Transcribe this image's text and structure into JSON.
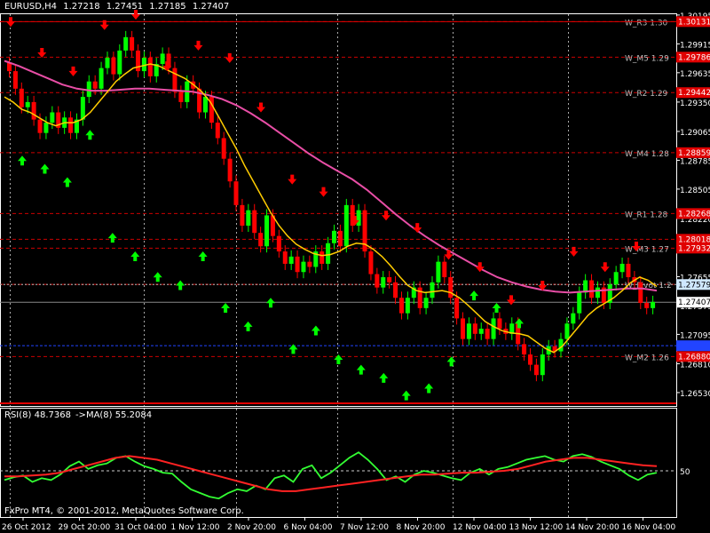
{
  "header": {
    "symbol": "EURUSD,H4",
    "open": "1.27218",
    "high": "1.27451",
    "low": "1.27185",
    "close": "1.27407"
  },
  "rsi_header": {
    "label": "RSI(8) 48.7368",
    "ma_label": "->MA(8) 55.2084"
  },
  "copyright": "FxPro MT4, © 2001-2012, MetaQuotes Software Corp.",
  "colors": {
    "background": "#000000",
    "axis": "#ffffff",
    "bull": "#00ff00",
    "bear": "#ff0000",
    "fast_ma": "#ffcc00",
    "slow_ma": "#e84ea6",
    "level_line": "#cc0000",
    "rsi": "#33ff33",
    "rsi_ma": "#ff2222"
  },
  "chart_data": [
    {
      "type": "candlestick",
      "title": "EURUSD,H4",
      "ylim": [
        1.264,
        1.3022
      ],
      "y_ticks": [
        "1.30195",
        "1.29915",
        "1.29635",
        "1.29350",
        "1.29065",
        "1.28785",
        "1.28505",
        "1.28220",
        "1.27655",
        "1.27375",
        "1.27095",
        "1.26810",
        "1.26530"
      ],
      "x_ticks": [
        "26 Oct 2012",
        "29 Oct 20:00",
        "31 Oct 04:00",
        "1 Nov 12:00",
        "2 Nov 20:00",
        "6 Nov 04:00",
        "7 Nov 12:00",
        "8 Nov 20:00",
        "12 Nov 04:00",
        "13 Nov 12:00",
        "14 Nov 20:00",
        "16 Nov 04:00"
      ],
      "grid": true,
      "current_price": "1.27407",
      "highlight_price": "1.27579",
      "levels": [
        {
          "name": "W_R3 1.30",
          "value": 1.30131,
          "tag": "1.30131"
        },
        {
          "name": "W_M5 1.29",
          "value": 1.29786,
          "tag": "1.29786"
        },
        {
          "name": "W_R2 1.29",
          "value": 1.29442,
          "tag": "1.29442"
        },
        {
          "name": "W_M4 1.28",
          "value": 1.28859,
          "tag": "1.28859"
        },
        {
          "name": "W_R1 1.28",
          "value": 1.28268,
          "tag": "1.28268"
        },
        {
          "name": "",
          "value": 1.28018,
          "tag": "1.28018"
        },
        {
          "name": "W_M3 1.27",
          "value": 1.27932,
          "tag": "1.27932"
        },
        {
          "name": "W_Pivot 1.2",
          "value": 1.2758,
          "tag": ""
        },
        {
          "name": "W_M2 1.26",
          "value": 1.2688,
          "tag": "1.26880"
        }
      ],
      "blue_level": 1.26985,
      "closes": [
        1.2965,
        1.2948,
        1.293,
        1.2935,
        1.2918,
        1.2905,
        1.2915,
        1.2925,
        1.291,
        1.292,
        1.2905,
        1.2918,
        1.294,
        1.2955,
        1.2948,
        1.2968,
        1.2978,
        1.2962,
        1.2985,
        1.2998,
        1.2985,
        1.2965,
        1.2978,
        1.296,
        1.2972,
        1.2982,
        1.2968,
        1.2945,
        1.2935,
        1.2955,
        1.2948,
        1.2925,
        1.294,
        1.2915,
        1.29,
        1.288,
        1.2858,
        1.2835,
        1.2815,
        1.283,
        1.2808,
        1.2795,
        1.2825,
        1.2805,
        1.279,
        1.2778,
        1.2785,
        1.277,
        1.278,
        1.2775,
        1.279,
        1.2778,
        1.2798,
        1.281,
        1.2795,
        1.2835,
        1.2815,
        1.283,
        1.279,
        1.2768,
        1.2755,
        1.2765,
        1.276,
        1.2745,
        1.273,
        1.2745,
        1.2755,
        1.2735,
        1.2745,
        1.276,
        1.278,
        1.2765,
        1.2745,
        1.2725,
        1.2705,
        1.272,
        1.271,
        1.2715,
        1.2705,
        1.2725,
        1.2715,
        1.271,
        1.272,
        1.27,
        1.269,
        1.268,
        1.267,
        1.269,
        1.2698,
        1.2693,
        1.2705,
        1.272,
        1.273,
        1.275,
        1.2762,
        1.2745,
        1.2755,
        1.274,
        1.2758,
        1.277,
        1.2778,
        1.2765,
        1.276,
        1.274,
        1.2735,
        1.2741
      ],
      "fast_ma": [
        1.294,
        1.2935,
        1.2928,
        1.2925,
        1.292,
        1.2915,
        1.2912,
        1.2915,
        1.2915,
        1.2918,
        1.2925,
        1.2935,
        1.2945,
        1.2955,
        1.2962,
        1.2968,
        1.297,
        1.2972,
        1.297,
        1.2966,
        1.2962,
        1.2958,
        1.2952,
        1.2945,
        1.2935,
        1.292,
        1.2905,
        1.289,
        1.2873,
        1.2858,
        1.2843,
        1.2828,
        1.2815,
        1.2805,
        1.2797,
        1.2792,
        1.2788,
        1.2786,
        1.2787,
        1.279,
        1.2795,
        1.2798,
        1.2797,
        1.2792,
        1.2785,
        1.2776,
        1.2766,
        1.2757,
        1.2752,
        1.275,
        1.2751,
        1.2752,
        1.275,
        1.2745,
        1.2738,
        1.273,
        1.2722,
        1.2717,
        1.2713,
        1.2711,
        1.271,
        1.2708,
        1.2702,
        1.2696,
        1.2692,
        1.2698,
        1.2708,
        1.2718,
        1.2728,
        1.2735,
        1.274,
        1.2745,
        1.2752,
        1.276,
        1.2765,
        1.2762,
        1.2756
      ],
      "slow_ma": [
        1.2975,
        1.297,
        1.2964,
        1.2958,
        1.2952,
        1.2948,
        1.2946,
        1.2946,
        1.2947,
        1.2948,
        1.2948,
        1.2947,
        1.2946,
        1.2945,
        1.2942,
        1.2938,
        1.2932,
        1.2924,
        1.2915,
        1.2905,
        1.2895,
        1.2885,
        1.2876,
        1.2868,
        1.286,
        1.285,
        1.2838,
        1.2826,
        1.2815,
        1.2805,
        1.2796,
        1.2788,
        1.278,
        1.2772,
        1.2765,
        1.276,
        1.2756,
        1.2753,
        1.2751,
        1.275,
        1.2751,
        1.2752,
        1.2753,
        1.2754,
        1.2754,
        1.2752
      ],
      "arrows_up": [
        1.2883,
        1.2875,
        1.2862,
        1.2908,
        1.2808,
        1.279,
        1.277,
        1.2762,
        1.279,
        1.274,
        1.2722,
        1.2745,
        1.27,
        1.2718,
        1.269,
        1.268,
        1.2672,
        1.2655,
        1.2662,
        1.2688,
        1.2752,
        1.274,
        1.2725
      ],
      "arrows_down": [
        1.3008,
        1.2978,
        1.296,
        1.3005,
        1.3015,
        1.2965,
        1.2985,
        1.2973,
        1.2925,
        1.2855,
        1.2843,
        1.2815,
        1.282,
        1.2808,
        1.2782,
        1.277,
        1.2738,
        1.2752,
        1.2785,
        1.277,
        1.279
      ]
    },
    {
      "type": "line",
      "title": "RSI(8) 48.7368 ->MA(8) 55.2084",
      "ylim": [
        0,
        100
      ],
      "y_ticks": [
        "50"
      ],
      "reference_level": 50,
      "series": [
        {
          "name": "RSI(8)",
          "values": [
            40,
            43,
            45,
            38,
            42,
            40,
            46,
            55,
            60,
            52,
            56,
            58,
            64,
            66,
            60,
            55,
            52,
            48,
            47,
            38,
            30,
            26,
            22,
            20,
            26,
            30,
            28,
            34,
            30,
            42,
            45,
            38,
            52,
            56,
            42,
            48,
            56,
            64,
            70,
            62,
            52,
            40,
            44,
            38,
            46,
            50,
            48,
            45,
            42,
            40,
            48,
            52,
            46,
            52,
            54,
            58,
            62,
            64,
            66,
            62,
            60,
            66,
            68,
            65,
            60,
            56,
            52,
            45,
            40,
            46,
            48
          ],
          "current": "48.7368"
        },
        {
          "name": "MA(8)",
          "values": [
            44,
            44,
            45,
            46,
            48,
            52,
            56,
            60,
            64,
            66,
            64,
            62,
            58,
            54,
            50,
            46,
            42,
            38,
            34,
            30,
            28,
            28,
            30,
            32,
            34,
            36,
            38,
            40,
            42,
            44,
            46,
            46,
            47,
            48,
            48,
            49,
            50,
            52,
            56,
            60,
            62,
            64,
            64,
            62,
            60,
            58,
            56,
            55
          ],
          "current": "55.2084"
        }
      ]
    }
  ]
}
